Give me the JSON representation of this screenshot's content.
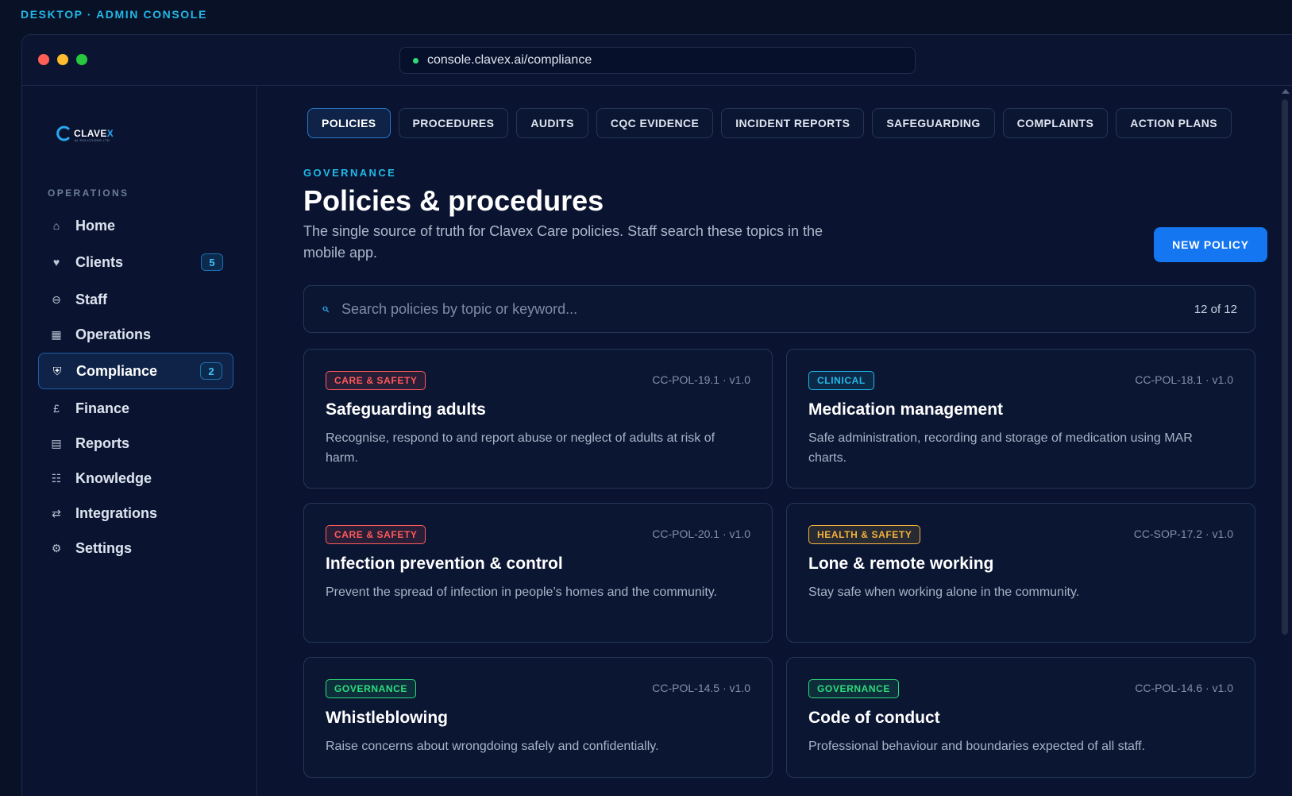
{
  "caption": "DESKTOP · ADMIN CONSOLE",
  "browser": {
    "url": "console.clavex.ai/compliance"
  },
  "logo": {
    "text_main": "CLAVE",
    "text_accent": "X",
    "subtext": "AI SOLUTIONS LTD"
  },
  "sidebar": {
    "section_label": "OPERATIONS",
    "items": [
      {
        "label": "Home",
        "icon": "home-icon",
        "glyph": "⌂"
      },
      {
        "label": "Clients",
        "icon": "heart-icon",
        "glyph": "♥",
        "badge": "5"
      },
      {
        "label": "Staff",
        "icon": "user-icon",
        "glyph": "⊖"
      },
      {
        "label": "Operations",
        "icon": "grid-icon",
        "glyph": "▦"
      },
      {
        "label": "Compliance",
        "icon": "shield-icon",
        "glyph": "⛨",
        "badge": "2",
        "active": true
      },
      {
        "label": "Finance",
        "icon": "pound-icon",
        "glyph": "£"
      },
      {
        "label": "Reports",
        "icon": "report-icon",
        "glyph": "▤"
      },
      {
        "label": "Knowledge",
        "icon": "list-icon",
        "glyph": "☷"
      },
      {
        "label": "Integrations",
        "icon": "swap-icon",
        "glyph": "⇄"
      },
      {
        "label": "Settings",
        "icon": "gear-icon",
        "glyph": "⚙"
      }
    ]
  },
  "tabs": [
    "POLICIES",
    "PROCEDURES",
    "AUDITS",
    "CQC EVIDENCE",
    "INCIDENT REPORTS",
    "SAFEGUARDING",
    "COMPLAINTS",
    "ACTION PLANS"
  ],
  "header": {
    "eyebrow": "GOVERNANCE",
    "title": "Policies & procedures",
    "description": "The single source of truth for Clavex Care policies. Staff search these topics in the mobile app.",
    "new_button": "NEW POLICY"
  },
  "search": {
    "placeholder": "Search policies by topic or keyword...",
    "count": "12 of 12"
  },
  "colors": {
    "accent": "#22b8e8",
    "primary": "#1476f0",
    "care_safety": "#ff5a5a",
    "clinical": "#22b8e8",
    "health_safety": "#f5b23c",
    "governance": "#2ddc7d"
  },
  "cards": [
    {
      "tag": "CARE & SAFETY",
      "tag_color": "#ff5a5a",
      "code": "CC-POL-19.1 · v1.0",
      "title": "Safeguarding adults",
      "description": "Recognise, respond to and report abuse or neglect of adults at risk of harm."
    },
    {
      "tag": "CLINICAL",
      "tag_color": "#22b8e8",
      "code": "CC-POL-18.1 · v1.0",
      "title": "Medication management",
      "description": "Safe administration, recording and storage of medication using MAR charts."
    },
    {
      "tag": "CARE & SAFETY",
      "tag_color": "#ff5a5a",
      "code": "CC-POL-20.1 · v1.0",
      "title": "Infection prevention & control",
      "description": "Prevent the spread of infection in people’s homes and the community."
    },
    {
      "tag": "HEALTH & SAFETY",
      "tag_color": "#f5b23c",
      "code": "CC-SOP-17.2 · v1.0",
      "title": "Lone & remote working",
      "description": "Stay safe when working alone in the community."
    },
    {
      "tag": "GOVERNANCE",
      "tag_color": "#2ddc7d",
      "code": "CC-POL-14.5 · v1.0",
      "title": "Whistleblowing",
      "description": "Raise concerns about wrongdoing safely and confidentially."
    },
    {
      "tag": "GOVERNANCE",
      "tag_color": "#2ddc7d",
      "code": "CC-POL-14.6 · v1.0",
      "title": "Code of conduct",
      "description": "Professional behaviour and boundaries expected of all staff."
    }
  ]
}
